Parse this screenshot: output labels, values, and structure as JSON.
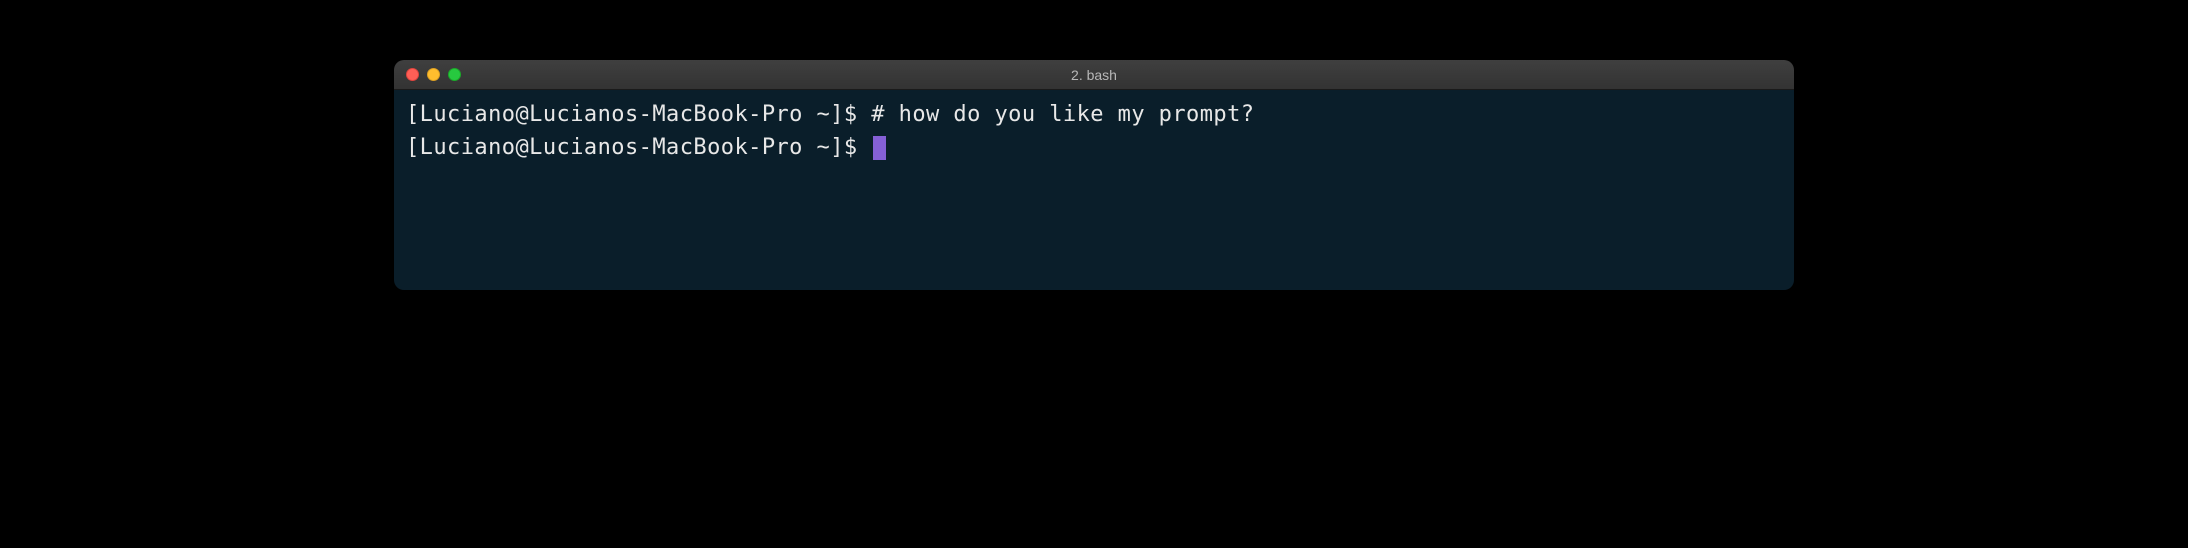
{
  "window": {
    "title": "2. bash"
  },
  "terminal": {
    "lines": [
      {
        "prompt": "[Luciano@Lucianos-MacBook-Pro ~]$ ",
        "command": "# how do you like my prompt?"
      },
      {
        "prompt": "[Luciano@Lucianos-MacBook-Pro ~]$ ",
        "command": ""
      }
    ]
  }
}
